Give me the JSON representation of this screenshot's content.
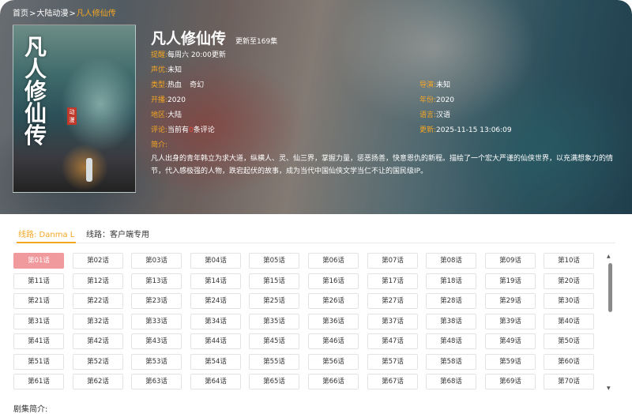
{
  "breadcrumb": {
    "home": "首页",
    "category": "大陆动漫",
    "current": "凡人修仙传",
    "separator": ">"
  },
  "poster": {
    "calligraphy": "凡人修仙传",
    "seal": "动漫"
  },
  "show": {
    "title": "凡人修仙传",
    "update_status": "更新至169集",
    "fields": {
      "schedule": {
        "label": "提醒:",
        "value": "每周六 20:00更新"
      },
      "cast": {
        "label": "声优:",
        "value": "未知"
      },
      "genre": {
        "label": "类型:",
        "values": [
          "热血",
          "奇幻"
        ]
      },
      "director": {
        "label": "导演:",
        "value": "未知"
      },
      "premiere": {
        "label": "开播:",
        "value": "2020"
      },
      "year": {
        "label": "年份:",
        "value": "2020"
      },
      "region": {
        "label": "地区:",
        "value": "大陆"
      },
      "language": {
        "label": "语言:",
        "value": "汉语"
      },
      "comments": {
        "label": "评论:",
        "before": "当前有",
        "count": "0",
        "after": "条评论"
      },
      "updated": {
        "label": "更新:",
        "value": "2025-11-15 13:06:09"
      },
      "intro": {
        "label": "简介:",
        "value": "凡人出身的青年韩立为求大道，纵横人、灵、仙三界，掌握力量，惩恶扬善，快意恩仇的新程。描绘了一个宏大严谨的仙侠世界，以充满想象力的情节，代入感极强的人物，跌宕起伏的故事，成为当代中国仙侠文学当仁不让的国民级IP。"
      }
    }
  },
  "tabs": [
    {
      "label": "线路: Danma L"
    },
    {
      "label": "线路：客户端专用"
    }
  ],
  "episodes": [
    "第01话",
    "第02话",
    "第03话",
    "第04话",
    "第05话",
    "第06话",
    "第07话",
    "第08话",
    "第09话",
    "第10话",
    "第11话",
    "第12话",
    "第13话",
    "第14话",
    "第15话",
    "第16话",
    "第17话",
    "第18话",
    "第19话",
    "第20话",
    "第21话",
    "第22话",
    "第23话",
    "第24话",
    "第25话",
    "第26话",
    "第27话",
    "第28话",
    "第29话",
    "第30话",
    "第31话",
    "第32话",
    "第33话",
    "第34话",
    "第35话",
    "第36话",
    "第37话",
    "第38话",
    "第39话",
    "第40话",
    "第41话",
    "第42话",
    "第43话",
    "第44话",
    "第45话",
    "第46话",
    "第47话",
    "第48话",
    "第49话",
    "第50话",
    "第51话",
    "第52话",
    "第53话",
    "第54话",
    "第55话",
    "第56话",
    "第57话",
    "第58话",
    "第59话",
    "第60话",
    "第61话",
    "第62话",
    "第63话",
    "第64话",
    "第65话",
    "第66话",
    "第67话",
    "第68话",
    "第69话",
    "第70话"
  ],
  "active_episode": "第01话",
  "scrollbar": {
    "up_icon": "▲",
    "down_icon": "▼"
  },
  "summary_label": "剧集简介:",
  "colors": {
    "accent": "#f5a623",
    "active_episode": "#f19a9e",
    "comment_count": "#e74c3c"
  }
}
